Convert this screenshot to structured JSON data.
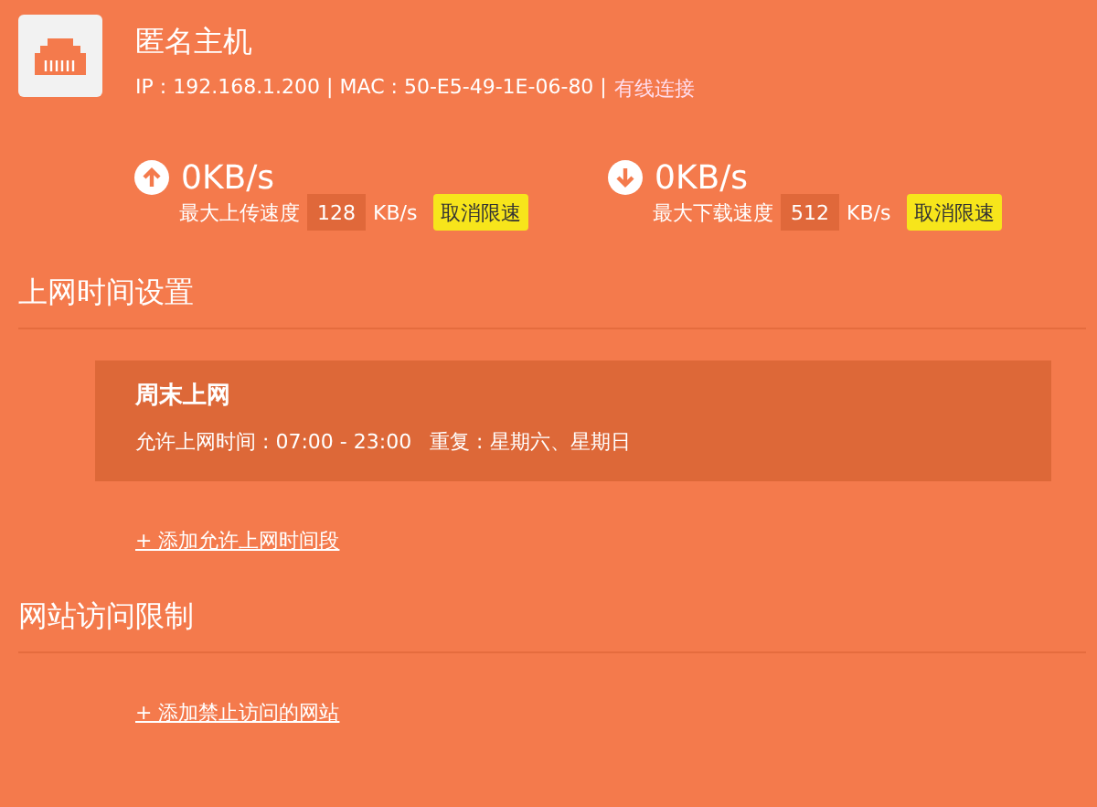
{
  "host": {
    "name": "匿名主机",
    "address": "IP : 192.168.1.200 | MAC : 50-E5-49-1E-06-80 |",
    "connection": "有线连接"
  },
  "speeds": [
    {
      "kind": "upload",
      "current": "0KB/s",
      "label": "最大上传速度",
      "value": "128",
      "unit": "KB/s",
      "button": "取消限速"
    },
    {
      "kind": "download",
      "current": "0KB/s",
      "label": "最大下载速度",
      "value": "512",
      "unit": "KB/s",
      "button": "取消限速"
    }
  ],
  "sections": [
    {
      "title": "上网时间设置",
      "schedules": [
        {
          "name": "周末上网",
          "allowed": "允许上网时间 : 07:00 - 23:00",
          "repeat": "重复 : 星期六、星期日"
        }
      ],
      "add_link": "+ 添加允许上网时间段"
    },
    {
      "title": "网站访问限制",
      "add_link": "+ 添加禁止访问的网站"
    }
  ]
}
